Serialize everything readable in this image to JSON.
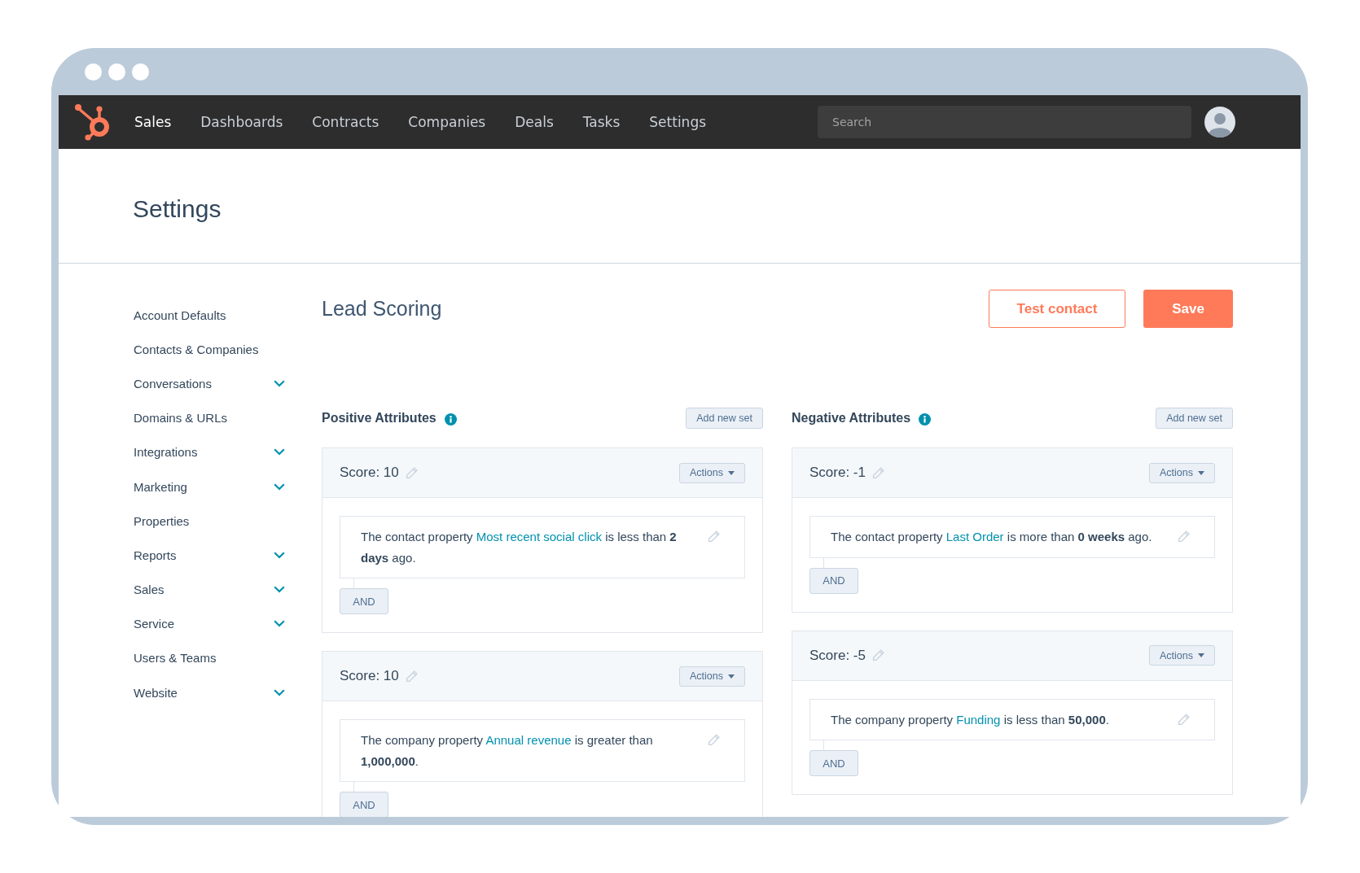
{
  "nav": {
    "items": [
      {
        "label": "Sales",
        "selected": true
      },
      {
        "label": "Dashboards",
        "selected": false
      },
      {
        "label": "Contracts",
        "selected": false
      },
      {
        "label": "Companies",
        "selected": false
      },
      {
        "label": "Deals",
        "selected": false
      },
      {
        "label": "Tasks",
        "selected": false
      },
      {
        "label": "Settings",
        "selected": false
      }
    ],
    "search": {
      "placeholder": "Search"
    }
  },
  "page": {
    "title": "Settings"
  },
  "sidebar": {
    "items": [
      {
        "label": "Account Defaults",
        "expandable": false
      },
      {
        "label": "Contacts & Companies",
        "expandable": false
      },
      {
        "label": "Conversations",
        "expandable": true
      },
      {
        "label": "Domains & URLs",
        "expandable": false
      },
      {
        "label": "Integrations",
        "expandable": true
      },
      {
        "label": "Marketing",
        "expandable": true
      },
      {
        "label": "Properties",
        "expandable": false
      },
      {
        "label": "Reports",
        "expandable": true
      },
      {
        "label": "Sales",
        "expandable": true
      },
      {
        "label": "Service",
        "expandable": true
      },
      {
        "label": "Users & Teams",
        "expandable": false
      },
      {
        "label": "Website",
        "expandable": true
      }
    ]
  },
  "main": {
    "title": "Lead Scoring",
    "buttons": [
      {
        "label": "Test contact",
        "kind": "outline"
      },
      {
        "label": "Save",
        "kind": "primary"
      }
    ],
    "columns": [
      {
        "title": "Positive Attributes",
        "add_button": "Add new set",
        "sets": [
          {
            "score": "Score: 10",
            "actions": "Actions",
            "condition": {
              "prefix": "The contact property",
              "property": "Most recent social click",
              "rest": "is less than **2 days** ago."
            },
            "and_button": "AND"
          },
          {
            "score": "Score: 10",
            "actions": "Actions",
            "condition": {
              "prefix": "The company property",
              "property": "Annual revenue",
              "rest": "is greater than **1,000,000**."
            },
            "and_button": "AND"
          }
        ]
      },
      {
        "title": "Negative Attributes",
        "add_button": "Add new set",
        "sets": [
          {
            "score": "Score: -1",
            "actions": "Actions",
            "condition": {
              "prefix": "The contact property",
              "property": "Last Order",
              "rest": "is more than **0 weeks** ago."
            },
            "and_button": "AND"
          },
          {
            "score": "Score: -5",
            "actions": "Actions",
            "condition": {
              "prefix": "The company property",
              "property": "Funding",
              "rest": "is less than **50,000**."
            },
            "and_button": "AND"
          }
        ]
      }
    ]
  }
}
